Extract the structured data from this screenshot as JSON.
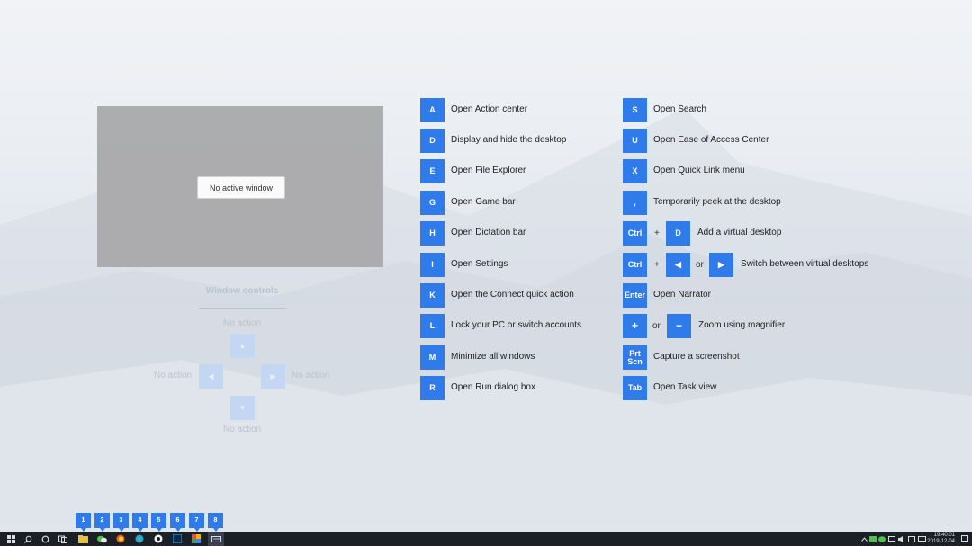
{
  "preview": {
    "label": "No active window"
  },
  "window_controls": {
    "title": "Window controls",
    "up_label": "No action",
    "down_label": "No action",
    "left_label": "No action",
    "right_label": "No action",
    "up_glyph": "▲",
    "down_glyph": "▼",
    "left_glyph": "◀",
    "right_glyph": "▶"
  },
  "shortcuts_left": [
    {
      "key": "A",
      "desc": "Open Action center"
    },
    {
      "key": "D",
      "desc": "Display and hide the desktop"
    },
    {
      "key": "E",
      "desc": "Open File Explorer"
    },
    {
      "key": "G",
      "desc": "Open Game bar"
    },
    {
      "key": "H",
      "desc": "Open Dictation bar"
    },
    {
      "key": "I",
      "desc": "Open Settings"
    },
    {
      "key": "K",
      "desc": "Open the Connect quick action"
    },
    {
      "key": "L",
      "desc": "Lock your PC or switch accounts"
    },
    {
      "key": "M",
      "desc": "Minimize all windows"
    },
    {
      "key": "R",
      "desc": "Open Run dialog box"
    }
  ],
  "shortcuts_right": {
    "s": {
      "key": "S",
      "desc": "Open Search"
    },
    "u": {
      "key": "U",
      "desc": "Open Ease of Access Center"
    },
    "x": {
      "key": "X",
      "desc": "Open Quick Link menu"
    },
    "comma": {
      "key": ",",
      "desc": "Temporarily peek at the desktop"
    },
    "ctrl_d": {
      "key1": "Ctrl",
      "plus": "+",
      "key2": "D",
      "desc": "Add a virtual desktop"
    },
    "ctrl_arrows": {
      "key1": "Ctrl",
      "plus": "+",
      "key2": "◀",
      "or": "or",
      "key3": "▶",
      "desc": "Switch between virtual desktops"
    },
    "enter": {
      "key": "Enter",
      "desc": "Open Narrator"
    },
    "zoom": {
      "key1": "+",
      "or": "or",
      "key2": "−",
      "desc": "Zoom using magnifier"
    },
    "prtscn": {
      "key": "Prt Scn",
      "desc": "Capture a screenshot"
    },
    "tab": {
      "key": "Tab",
      "desc": "Open Task view"
    }
  },
  "taskbar": {
    "badges": [
      "1",
      "2",
      "3",
      "4",
      "5",
      "6",
      "7",
      "8"
    ],
    "icons": [
      "windows-logo-icon",
      "search-icon",
      "cortana-icon",
      "task-view-icon",
      "file-explorer-icon",
      "wechat-icon",
      "firefox-icon",
      "edge-icon",
      "chrome-icon",
      "photoshop-icon",
      "app-icon",
      "keyboard-app-icon"
    ],
    "clock": {
      "time": "19:40:01",
      "date": "2019-12-04"
    }
  }
}
